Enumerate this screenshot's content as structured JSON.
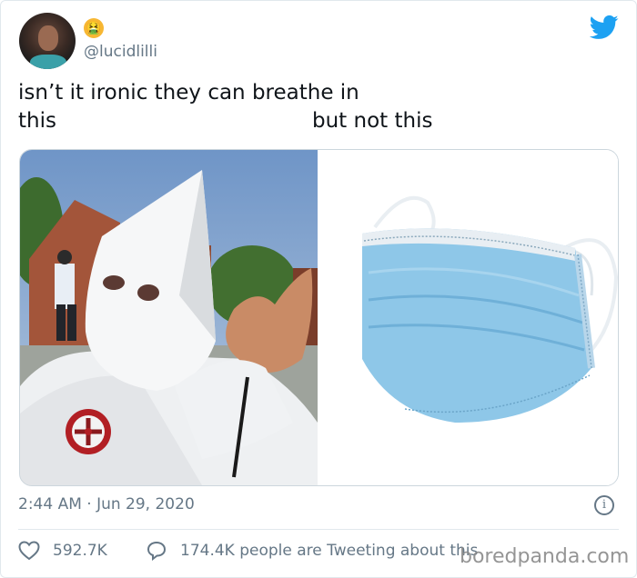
{
  "tweet": {
    "handle": "@lucidlilli",
    "text_line1": "isn’t it ironic they can breathe in",
    "text_left": "this",
    "text_right": "but not this",
    "timestamp": "2:44 AM · Jun 29, 2020",
    "likes": "592.7K",
    "replies_text": "174.4K people are Tweeting about this",
    "emoji": "🤮"
  },
  "icons": {
    "brand": "twitter-bird-icon",
    "heart": "heart-icon",
    "reply": "speech-bubble-icon",
    "info": "info-icon"
  },
  "watermark": "boredpanda.com",
  "colors": {
    "twitter_blue": "#1da1f2",
    "muted": "#657786"
  }
}
